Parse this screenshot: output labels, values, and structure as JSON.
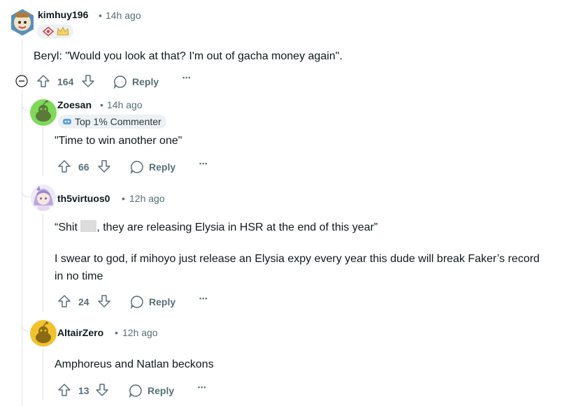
{
  "comments": [
    {
      "username": "kimhuy196",
      "time": "14h ago",
      "body": "Beryl: \"Would you look at that? I'm out of gacha money again\".",
      "votes": "164",
      "reply_label": "Reply",
      "avatar_color": "#8fb8c8"
    },
    {
      "username": "Zoesan",
      "time": "14h ago",
      "flair": "Top 1% Commenter",
      "body": "\"Time to win another one\"",
      "votes": "66",
      "reply_label": "Reply",
      "avatar_color": "#7ed957"
    },
    {
      "username": "th5virtuos0",
      "time": "12h ago",
      "body_line1_prefix": "“Shit ",
      "body_line1_suffix": ", they are releasing Elysia in HSR at the end of this year”",
      "body_p2_line1": "I swear to god, if mihoyo just release an Elysia expy every year this dude will break Faker’s record",
      "body_p2_line2": "in no time",
      "votes": "24",
      "reply_label": "Reply",
      "avatar_color": "#c9bde6"
    },
    {
      "username": "AltairZero",
      "time": "12h ago",
      "body": "Amphoreus and Natlan beckons",
      "votes": "13",
      "reply_label": "Reply",
      "avatar_color": "#f2c12e"
    }
  ],
  "more_label": "•••",
  "separator": "•"
}
